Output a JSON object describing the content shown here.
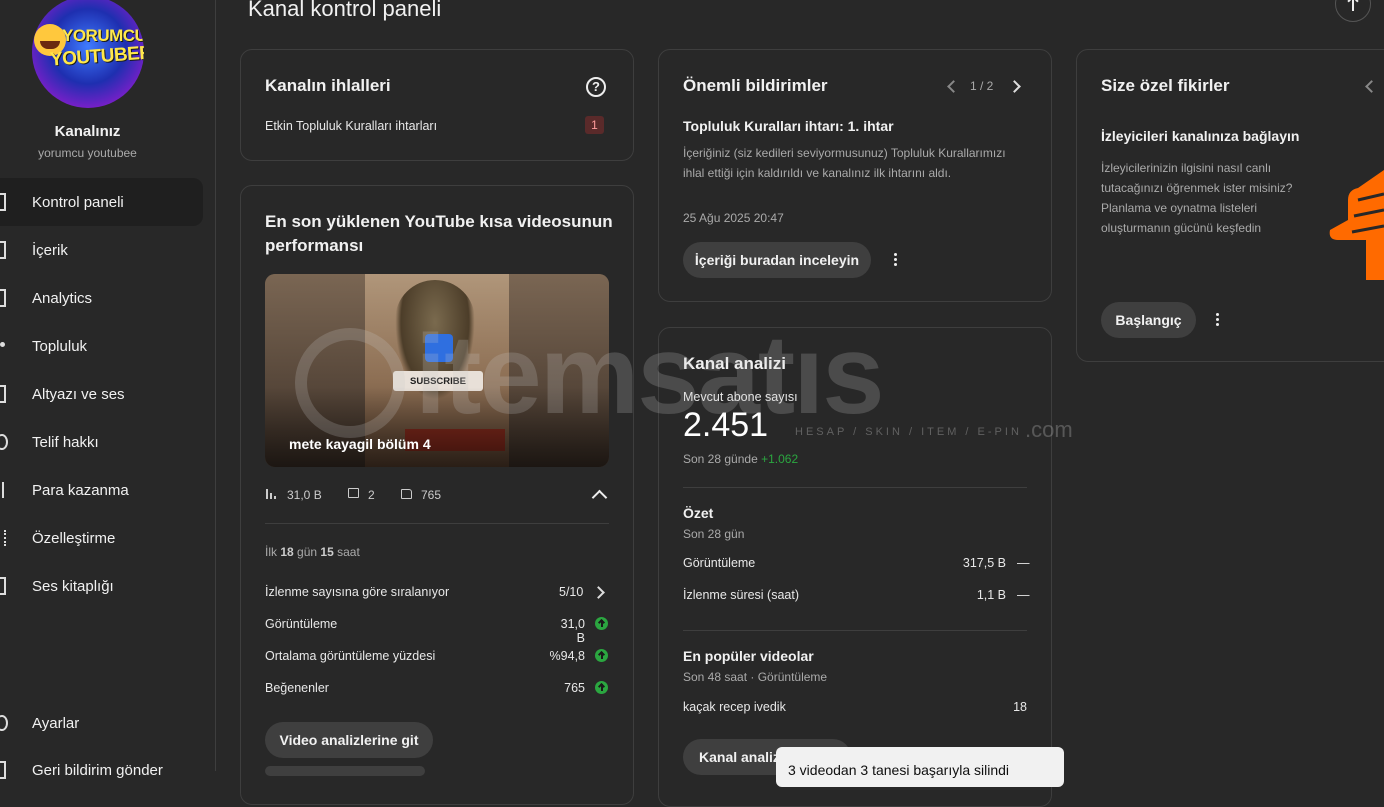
{
  "sidebar": {
    "channel_label": "Kanalınız",
    "channel_handle": "yorumcu youtubee",
    "avatar_text_line1": "YORUMCU",
    "avatar_text_line2": "YOUTUBER",
    "items": [
      {
        "label": "Kontrol paneli",
        "icon": "dashboard-icon"
      },
      {
        "label": "İçerik",
        "icon": "content-icon"
      },
      {
        "label": "Analytics",
        "icon": "analytics-icon"
      },
      {
        "label": "Topluluk",
        "icon": "community-icon"
      },
      {
        "label": "Altyazı ve ses",
        "icon": "subtitles-icon"
      },
      {
        "label": "Telif hakkı",
        "icon": "copyright-icon"
      },
      {
        "label": "Para kazanma",
        "icon": "monetization-icon"
      },
      {
        "label": "Özelleştirme",
        "icon": "customization-icon"
      },
      {
        "label": "Ses kitaplığı",
        "icon": "audio-library-icon"
      }
    ],
    "settings_label": "Ayarlar",
    "feedback_label": "Geri bildirim gönder"
  },
  "header": {
    "title": "Kanal kontrol paneli"
  },
  "violations": {
    "title": "Kanalın ihlalleri",
    "row_label": "Etkin Topluluk Kuralları ihtarları",
    "row_count": "1"
  },
  "latest_short": {
    "title_line1": "En son yüklenen YouTube kısa videosunun",
    "title_line2": "performansı",
    "thumbnail_caption": "mete kayagil bölüm 4",
    "thumbnail_subscribe": "SUBSCRIBE",
    "views": "31,0 B",
    "comments": "2",
    "likes": "765",
    "period_prefix": "İlk ",
    "period_days": "18",
    "period_mid": " gün ",
    "period_hours": "15",
    "period_suffix": " saat",
    "rank_label": "İzlenme sayısına göre sıralanıyor",
    "rank_value": "5/10",
    "stats": [
      {
        "label": "Görüntüleme",
        "value": "31,0 B"
      },
      {
        "label": "Ortalama görüntüleme yüzdesi",
        "value": "%94,8"
      },
      {
        "label": "Beğenenler",
        "value": "765"
      }
    ],
    "button_label": "Video analizlerine git"
  },
  "notifications": {
    "title": "Önemli bildirimler",
    "pager": "1 / 2",
    "item_title": "Topluluk Kuralları ihtarı: 1. ihtar",
    "item_body_line1": "İçeriğiniz (siz kedileri seviyormusunuz) Topluluk Kurallarımızı",
    "item_body_line2": "ihlal ettiği için kaldırıldı ve kanalınız ilk ihtarını aldı.",
    "item_date": "25 Ağu 2025 20:47",
    "button_label": "İçeriği buradan inceleyin"
  },
  "analytics": {
    "title": "Kanal analizi",
    "subs_label": "Mevcut abone sayısı",
    "subs_value": "2.451",
    "subs_period": "Son 28 günde",
    "subs_delta": "+1.062",
    "summary_title": "Özet",
    "summary_period": "Son 28 gün",
    "summary_rows": [
      {
        "label": "Görüntüleme",
        "value": "317,5 B",
        "trend": "—"
      },
      {
        "label": "İzlenme süresi (saat)",
        "value": "1,1 B",
        "trend": "—"
      }
    ],
    "top_videos_title": "En popüler videolar",
    "top_videos_period": "Son 48 saat · Görüntüleme",
    "top_videos": [
      {
        "title": "kaçak recep ivedik",
        "views": "18"
      }
    ],
    "button_label": "Kanal analiz"
  },
  "ideas": {
    "title": "Size özel fikirler",
    "item_title": "İzleyicileri kanalınıza bağlayın",
    "body_line1": "İzleyicilerinizin ilgisini nasıl canlı",
    "body_line2": "tutacağınızı öğrenmek ister misiniz?",
    "body_line3": "Planlama ve oynatma listeleri",
    "body_line4": "oluşturmanın gücünü keşfedin",
    "button_label": "Başlangıç"
  },
  "watermark": {
    "brand": "itemsatıs",
    "tagline": "HESAP / SKIN / ITEM / E-PIN",
    "domain": ".com"
  },
  "toast": {
    "text": "3 videodan 3 tanesi başarıyla silindi"
  },
  "colors": {
    "background": "#282828",
    "positive": "#2ba640",
    "violation_badge": "#5a2a2a"
  }
}
